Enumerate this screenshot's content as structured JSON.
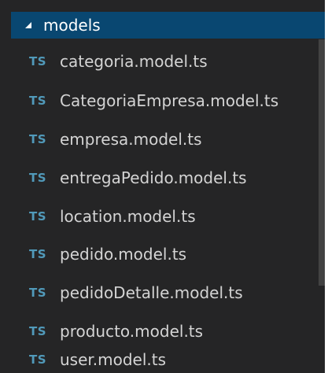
{
  "explorer": {
    "folder": {
      "name": "models",
      "expanded": true
    },
    "file_icon_text": "TS",
    "files": [
      "categoria.model.ts",
      "CategoriaEmpresa.model.ts",
      "empresa.model.ts",
      "entregaPedido.model.ts",
      "location.model.ts",
      "pedido.model.ts",
      "pedidoDetalle.model.ts",
      "producto.model.ts",
      "user.model.ts"
    ]
  },
  "colors": {
    "panel_background": "#252526",
    "selected_background": "#094771",
    "file_text": "#d4d4d4",
    "folder_text": "#ffffff",
    "typescript_icon": "#519aba",
    "scrollbar": "#424242"
  }
}
